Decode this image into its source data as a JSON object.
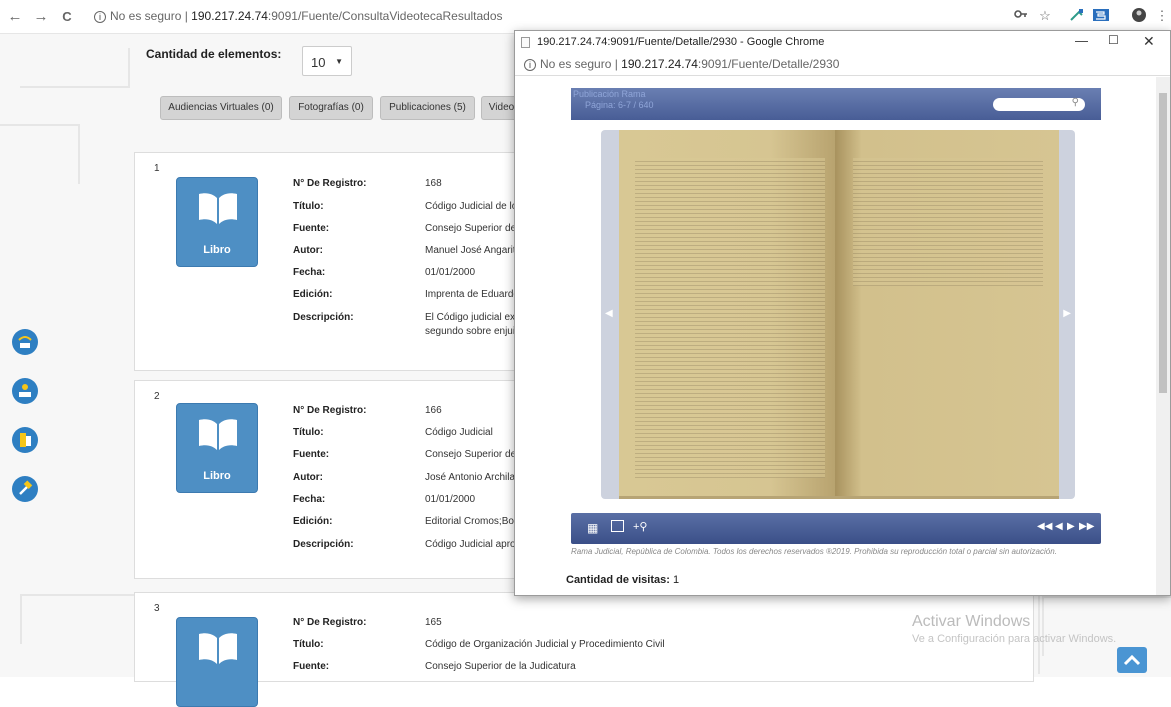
{
  "browser": {
    "back_icon": "←",
    "forward_icon": "→",
    "reload_icon": "C",
    "security_label": "No es seguro",
    "host": "190.217.24.74",
    "path": ":9091/Fuente/ConsultaVideotecaResultados"
  },
  "filters": {
    "count_label": "Cantidad de elementos:",
    "count_value": "10"
  },
  "tabs": [
    {
      "label": "Audiencias Virtuales (0)"
    },
    {
      "label": "Fotografías (0)"
    },
    {
      "label": "Publicaciones (5)"
    },
    {
      "label": "Video"
    }
  ],
  "field_labels": {
    "registro": "N° De Registro:",
    "titulo": "Título:",
    "fuente": "Fuente:",
    "autor": "Autor:",
    "fecha": "Fecha:",
    "edicion": "Edición:",
    "descripcion": "Descripción:"
  },
  "results": [
    {
      "number": "1",
      "type_label": "Libro",
      "registro": "168",
      "titulo": "Código Judicial de lo",
      "fuente": "Consejo Superior de",
      "autor": "Manuel José Angarit",
      "fecha": "01/01/2000",
      "edicion": "Imprenta de Eduardo",
      "descripcion_1": "El Código judicial ex",
      "descripcion_2": "segundo sobre enjui"
    },
    {
      "number": "2",
      "type_label": "Libro",
      "registro": "166",
      "titulo": "Código Judicial",
      "fuente": "Consejo Superior de",
      "autor": "José Antonio Archila",
      "fecha": "01/01/2000",
      "edicion": "Editorial Cromos;Bog",
      "descripcion_1": "Código Judicial apro"
    },
    {
      "number": "3",
      "registro": "165",
      "titulo": "Código de Organización Judicial y Procedimiento Civil",
      "fuente": "Consejo Superior de la Judicatura"
    }
  ],
  "windows_watermark": {
    "title": "Activar Windows",
    "subtitle": "Ve a Configuración para activar Windows."
  },
  "popup": {
    "title": "190.217.24.74:9091/Fuente/Detalle/2930 - Google Chrome",
    "security_label": "No es seguro",
    "host": "190.217.24.74",
    "path": ":9091/Fuente/Detalle/2930",
    "viewer_title": "Publicación Rama",
    "viewer_page": "Página: 6-7 / 640",
    "copyright": "Rama Judicial, República de Colombia. Todos los derechos reservados ®2019. Prohibida su reproducción total o parcial sin autorización.",
    "visits_label": "Cantidad de visitas:",
    "visits_value": "1"
  },
  "colors": {
    "accent_blue": "#2e7fc2",
    "book_tile": "#4e8fc4",
    "viewer_bar": "#485d96"
  }
}
